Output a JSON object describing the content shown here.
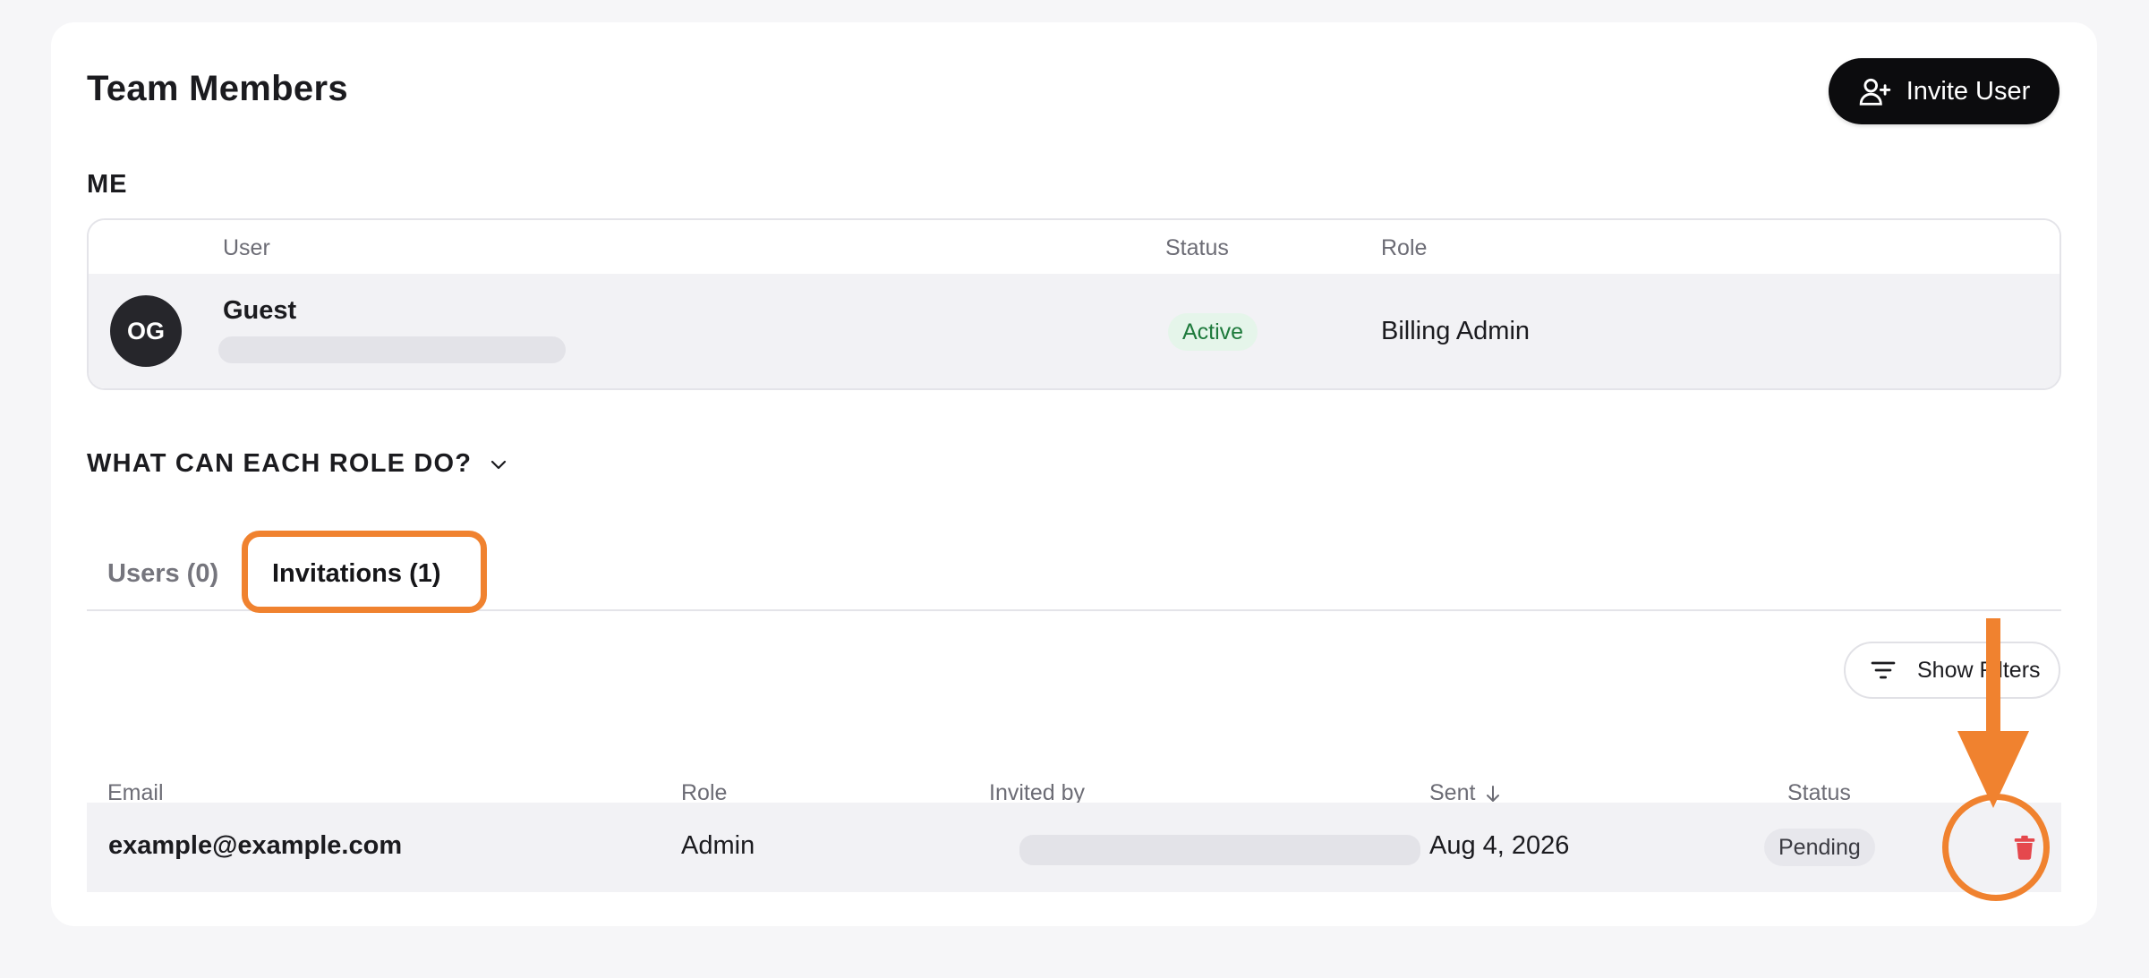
{
  "header": {
    "title": "Team Members",
    "invite_label": "Invite User",
    "invite_icon": "user-plus-icon"
  },
  "me": {
    "section_label": "ME",
    "columns": {
      "user": "User",
      "status": "Status",
      "role": "Role"
    },
    "user": {
      "initials": "OG",
      "name": "Guest",
      "status": "Active",
      "role": "Billing Admin"
    }
  },
  "roles_toggle": {
    "label": "WHAT CAN EACH ROLE DO?",
    "icon": "chevron-down-icon"
  },
  "tabs": [
    {
      "label": "Users (0)",
      "active": false
    },
    {
      "label": "Invitations (1)",
      "active": true
    }
  ],
  "filters": {
    "label": "Show Filters",
    "icon": "filter-icon"
  },
  "invitations": {
    "columns": {
      "email": "Email",
      "role": "Role",
      "invited_by": "Invited by",
      "sent": "Sent",
      "status": "Status"
    },
    "rows": [
      {
        "email": "example@example.com",
        "role": "Admin",
        "sent": "Aug 4, 2026",
        "status": "Pending"
      }
    ]
  },
  "colors": {
    "accent_highlight": "#f0822f",
    "primary_button": "#0c0c0e",
    "delete": "#e5484d",
    "active_badge": "#e5f5ea",
    "pending_badge": "#e7e7ec"
  }
}
